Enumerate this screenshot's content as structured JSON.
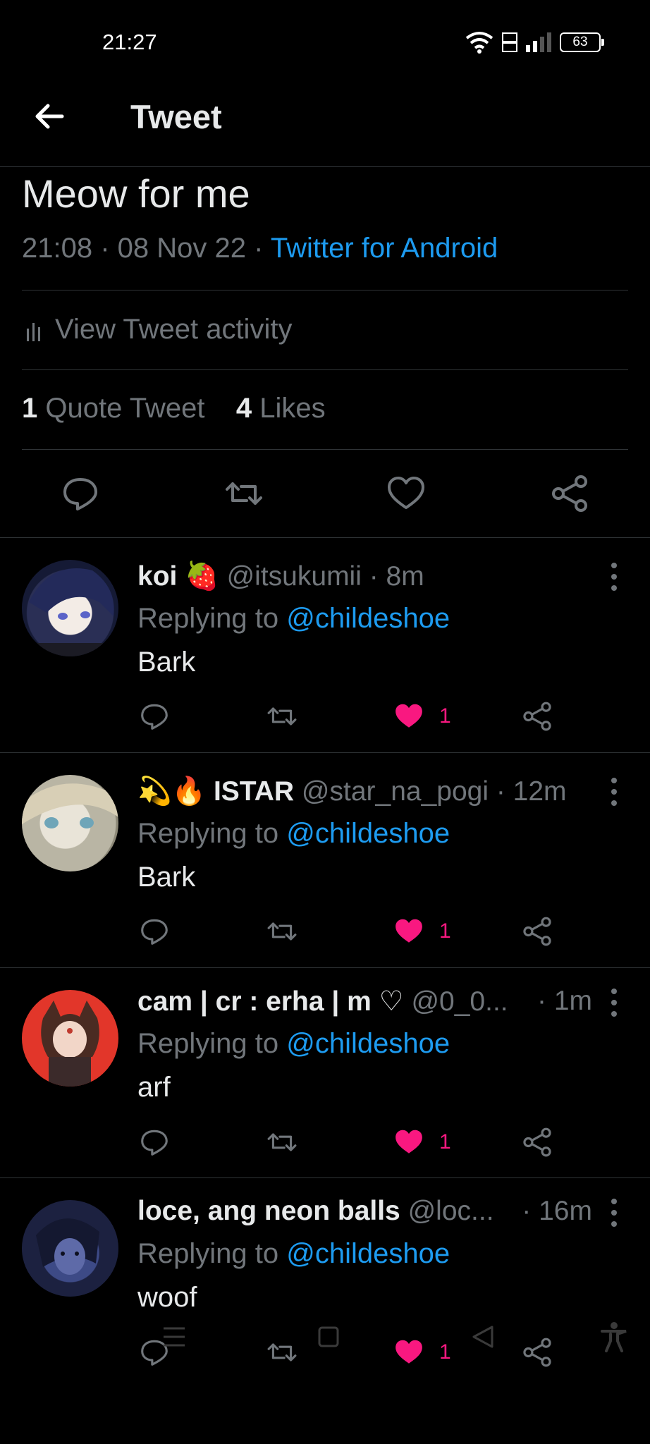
{
  "status": {
    "time": "21:27",
    "battery": "63"
  },
  "header": {
    "title": "Tweet"
  },
  "tweet": {
    "text": "Meow for me",
    "time": "21:08",
    "date": "08 Nov 22",
    "source": "Twitter for Android",
    "activity_label": "View Tweet activity",
    "quote_count": "1",
    "quote_label": "Quote Tweet",
    "likes_count": "4",
    "likes_label": "Likes"
  },
  "replies": [
    {
      "name": "koi 🍓",
      "handle": "@itsukumii",
      "time": "· 8m",
      "replying_prefix": "Replying to",
      "replying_to": "@childeshoe",
      "text": "Bark",
      "likes": "1"
    },
    {
      "name": "💫🔥 ISTAR",
      "handle": "@star_na_pogi",
      "time": "· 12m",
      "replying_prefix": "Replying to",
      "replying_to": "@childeshoe",
      "text": "Bark",
      "likes": "1"
    },
    {
      "name": "cam | cr : erha | m ♡",
      "handle": "@0_0...",
      "time": "· 1m",
      "replying_prefix": "Replying to",
      "replying_to": "@childeshoe",
      "text": "arf",
      "likes": "1"
    },
    {
      "name": "loce, ang neon balls",
      "handle": "@loc...",
      "time": "· 16m",
      "replying_prefix": "Replying to",
      "replying_to": "@childeshoe",
      "text": "woof",
      "likes": "1"
    }
  ],
  "colors": {
    "accent": "#1d9bf0",
    "like": "#f91880",
    "muted": "#71767b",
    "background": "#000000"
  },
  "icons": [
    "back-arrow-icon",
    "reply-icon",
    "retweet-icon",
    "like-icon",
    "share-icon",
    "more-icon",
    "analytics-icon"
  ]
}
